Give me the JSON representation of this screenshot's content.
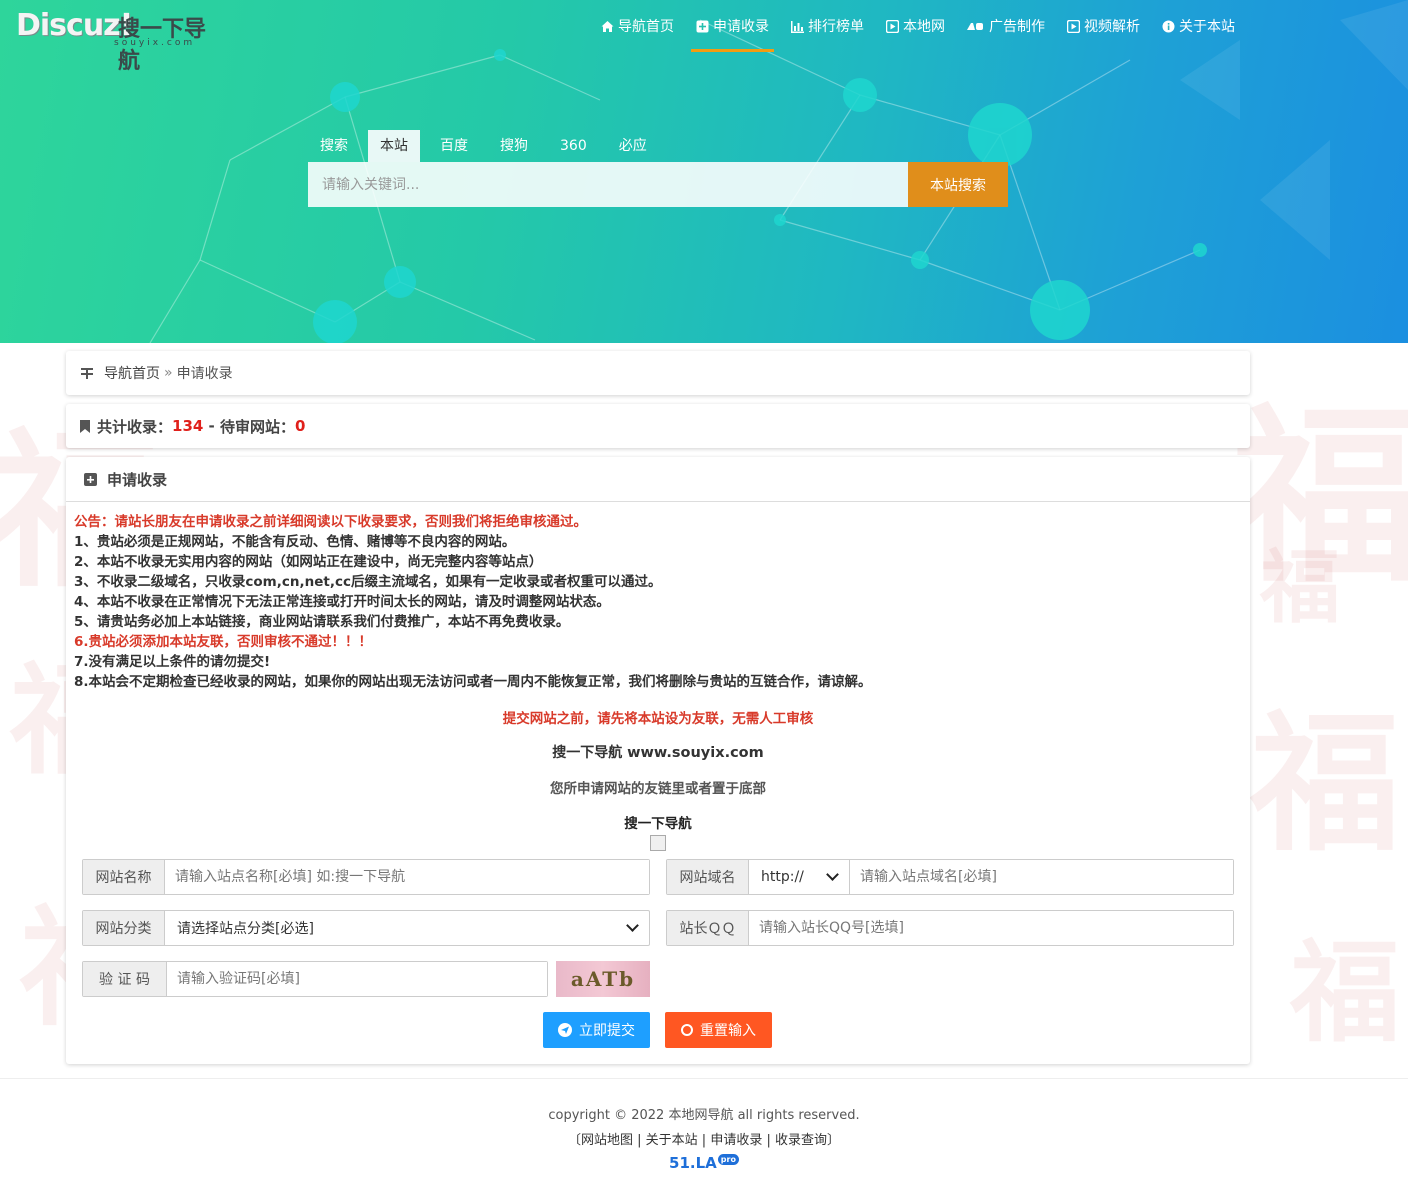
{
  "logo": {
    "brand": "Discuz!",
    "name": "搜一下导航",
    "sub": "souyix.com"
  },
  "nav": [
    {
      "label": "导航首页",
      "icon": "home-icon",
      "active": false
    },
    {
      "label": "申请收录",
      "icon": "plus-square-icon",
      "active": true
    },
    {
      "label": "排行榜单",
      "icon": "bar-chart-icon",
      "active": false
    },
    {
      "label": "本地网",
      "icon": "play-square-icon",
      "active": false
    },
    {
      "label": "广告制作",
      "icon": "ad-icon",
      "active": false
    },
    {
      "label": "视频解析",
      "icon": "video-icon",
      "active": false
    },
    {
      "label": "关于本站",
      "icon": "info-icon",
      "active": false
    }
  ],
  "search": {
    "tabs": [
      "搜索",
      "本站",
      "百度",
      "搜狗",
      "360",
      "必应"
    ],
    "active_tab": 1,
    "placeholder": "请输入关键词...",
    "button": "本站搜索"
  },
  "breadcrumb": {
    "home": "导航首页",
    "sep": "»",
    "current": "申请收录"
  },
  "stats": {
    "total_label": "共计收录：",
    "total": "134",
    "dash": " - ",
    "pending_label": "待审网站：",
    "pending": "0"
  },
  "form": {
    "title": "申请收录",
    "notice": "公告：请站长朋友在申请收录之前详细阅读以下收录要求，否则我们将拒绝审核通过。",
    "rules": [
      "1、贵站必须是正规网站，不能含有反动、色情、赌博等不良内容的网站。",
      "2、本站不收录无实用内容的网站（如网站正在建设中，尚无完整内容等站点）",
      "3、不收录二级域名，只收录com,cn,net,cc后缀主流域名，如果有一定收录或者权重可以通过。",
      "4、本站不收录在正常情况下无法正常连接或打开时间太长的网站，请及时调整网站状态。",
      "5、请贵站务必加上本站链接，商业网站请联系我们付费推广，本站不再免费收录。",
      "6.贵站必须添加本站友联，否则审核不通过！！！",
      "7.没有满足以上条件的请勿提交!",
      "8.本站会不定期检查已经收录的网站，如果你的网站出现无法访问或者一周内不能恢复正常，我们将删除与贵站的互链合作，请谅解。"
    ],
    "center_red": "提交网站之前，请先将本站设为友联，无需人工审核",
    "center_site_name": "搜一下导航",
    "center_site_url": "www.souyix.com",
    "center_hint": "您所申请网站的友链里或者置于底部",
    "center_name": "搜一下导航",
    "fields": {
      "name_label": "网站名称",
      "name_placeholder": "请输入站点名称[必填] 如:搜一下导航",
      "domain_label": "网站域名",
      "protocol": "http://",
      "domain_placeholder": "请输入站点域名[必填]",
      "category_label": "网站分类",
      "category_value": "请选择站点分类[必选]",
      "qq_label": "站长ＱＱ",
      "qq_placeholder": "请输入站长QQ号[选填]",
      "captcha_label": "验 证 码",
      "captcha_placeholder": "请输入验证码[必填]",
      "captcha_text": "aATb"
    },
    "submit": "立即提交",
    "reset": "重置输入"
  },
  "footer": {
    "copyright": "copyright © 2022 本地网导航 all rights reserved.",
    "links": [
      "网站地图",
      "关于本站",
      "申请收录",
      "收录查询"
    ],
    "badge": "51.LA",
    "badge_pro": "pro"
  },
  "colors": {
    "accent_orange": "#e08e1b",
    "red": "#e0201b",
    "submit_blue": "#1e9fff",
    "reset_orange": "#ff5722"
  }
}
